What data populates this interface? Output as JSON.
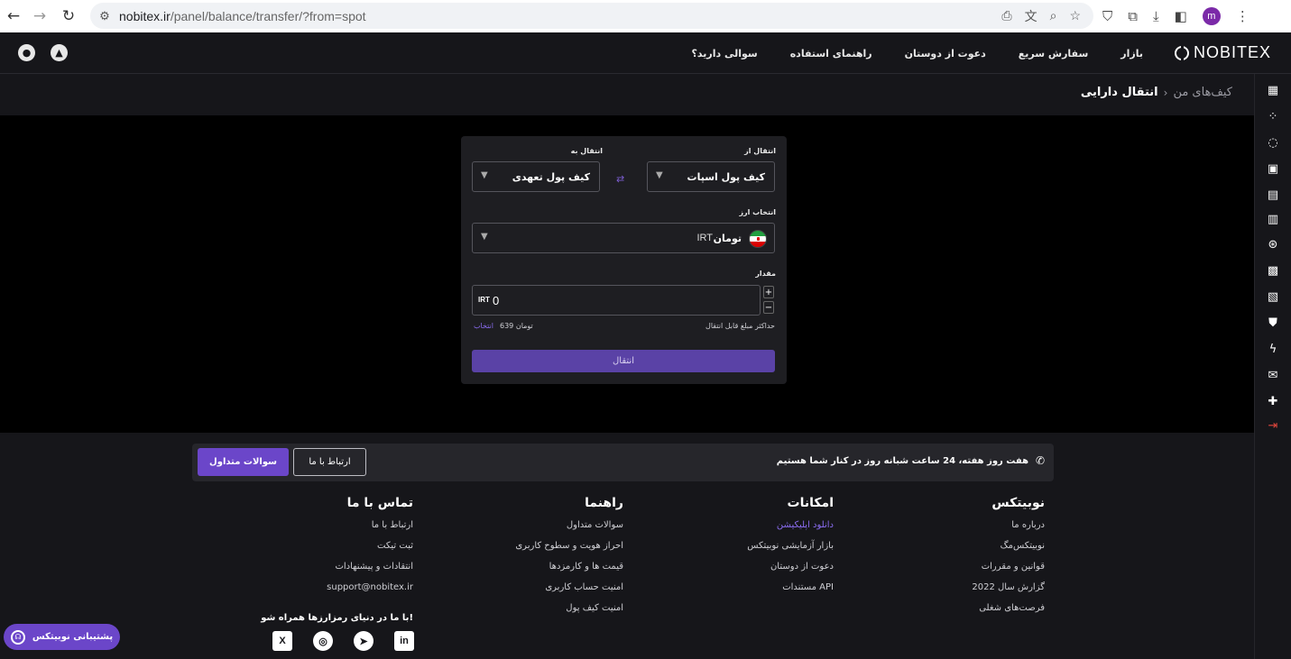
{
  "browser": {
    "back_icon": "←",
    "forward_icon": "→",
    "reload_icon": "↻",
    "url_host": "nobitex.ir",
    "url_path": "/panel/balance/transfer/?from=spot",
    "profile_initial": "m"
  },
  "header": {
    "logo_text": "NOBITEX",
    "nav": [
      "بازار",
      "سفارش سریع",
      "دعوت از دوستان",
      "راهنمای استفاده",
      "سوالی دارید؟"
    ]
  },
  "breadcrumb": {
    "parent": "کیف‌های من",
    "separator": "›",
    "current": "انتقال دارایی"
  },
  "transfer": {
    "from_label": "انتقال از",
    "from_value": "کیف پول اسپات",
    "to_label": "انتقال به",
    "to_value": "کیف پول تعهدی",
    "asset_label": "انتخاب ارز",
    "asset_name": "تومان",
    "asset_code": "IRT",
    "amount_label": "مقدار",
    "amount_value": "0",
    "amount_unit": "IRT",
    "stepper_plus": "+",
    "stepper_minus": "−",
    "max_label": "حداکثر مبلغ قابل انتقال",
    "max_value": "639 تومان",
    "max_select": "انتخاب",
    "submit_label": "انتقال"
  },
  "footer": {
    "strip_text": "هفت روز هفته، 24 ساعت شبانه روز در کنار شما هستیم",
    "contact_button": "ارتباط با ما",
    "faq_button": "سوالات متداول",
    "columns": [
      {
        "title": "نوبیتکس",
        "links": [
          "درباره ما",
          "نوبیتکس‌مگ",
          "قوانین و مقررات",
          "گزارش سال 2022",
          "فرصت‌های شغلی"
        ]
      },
      {
        "title": "امکانات",
        "links": [
          "دانلود اپلیکیشن",
          "بازار آزمایشی نوبیتکس",
          "دعوت از دوستان",
          "مستندات API"
        ]
      },
      {
        "title": "راهنما",
        "links": [
          "سوالات متداول",
          "احراز هویت و سطوح کاربری",
          "قیمت ها و کارمزدها",
          "امنیت حساب کاربری",
          "امنیت کیف پول"
        ]
      },
      {
        "title": "تماس با ما",
        "links": [
          "ارتباط با ما",
          "ثبت تیکت",
          "انتقادات و پیشنهادات",
          "support@nobitex.ir"
        ]
      }
    ],
    "social_title": "با ما در دنیای رمزارزها همراه شو!",
    "support_pill": "پشتیبانی نوبیتکس"
  },
  "colors": {
    "accent": "#6b46c9",
    "link_accent": "#8a6cf0",
    "logout": "#e0463c"
  },
  "icons": {
    "sidebar": [
      "dashboard-icon",
      "market-icon",
      "loading-icon",
      "wallet-icon",
      "chart-icon",
      "clipboard-icon",
      "exchange-icon",
      "profile-icon",
      "calendar-icon",
      "shield-icon",
      "bolt-icon",
      "mail-icon",
      "add-user-icon",
      "logout-icon"
    ]
  }
}
